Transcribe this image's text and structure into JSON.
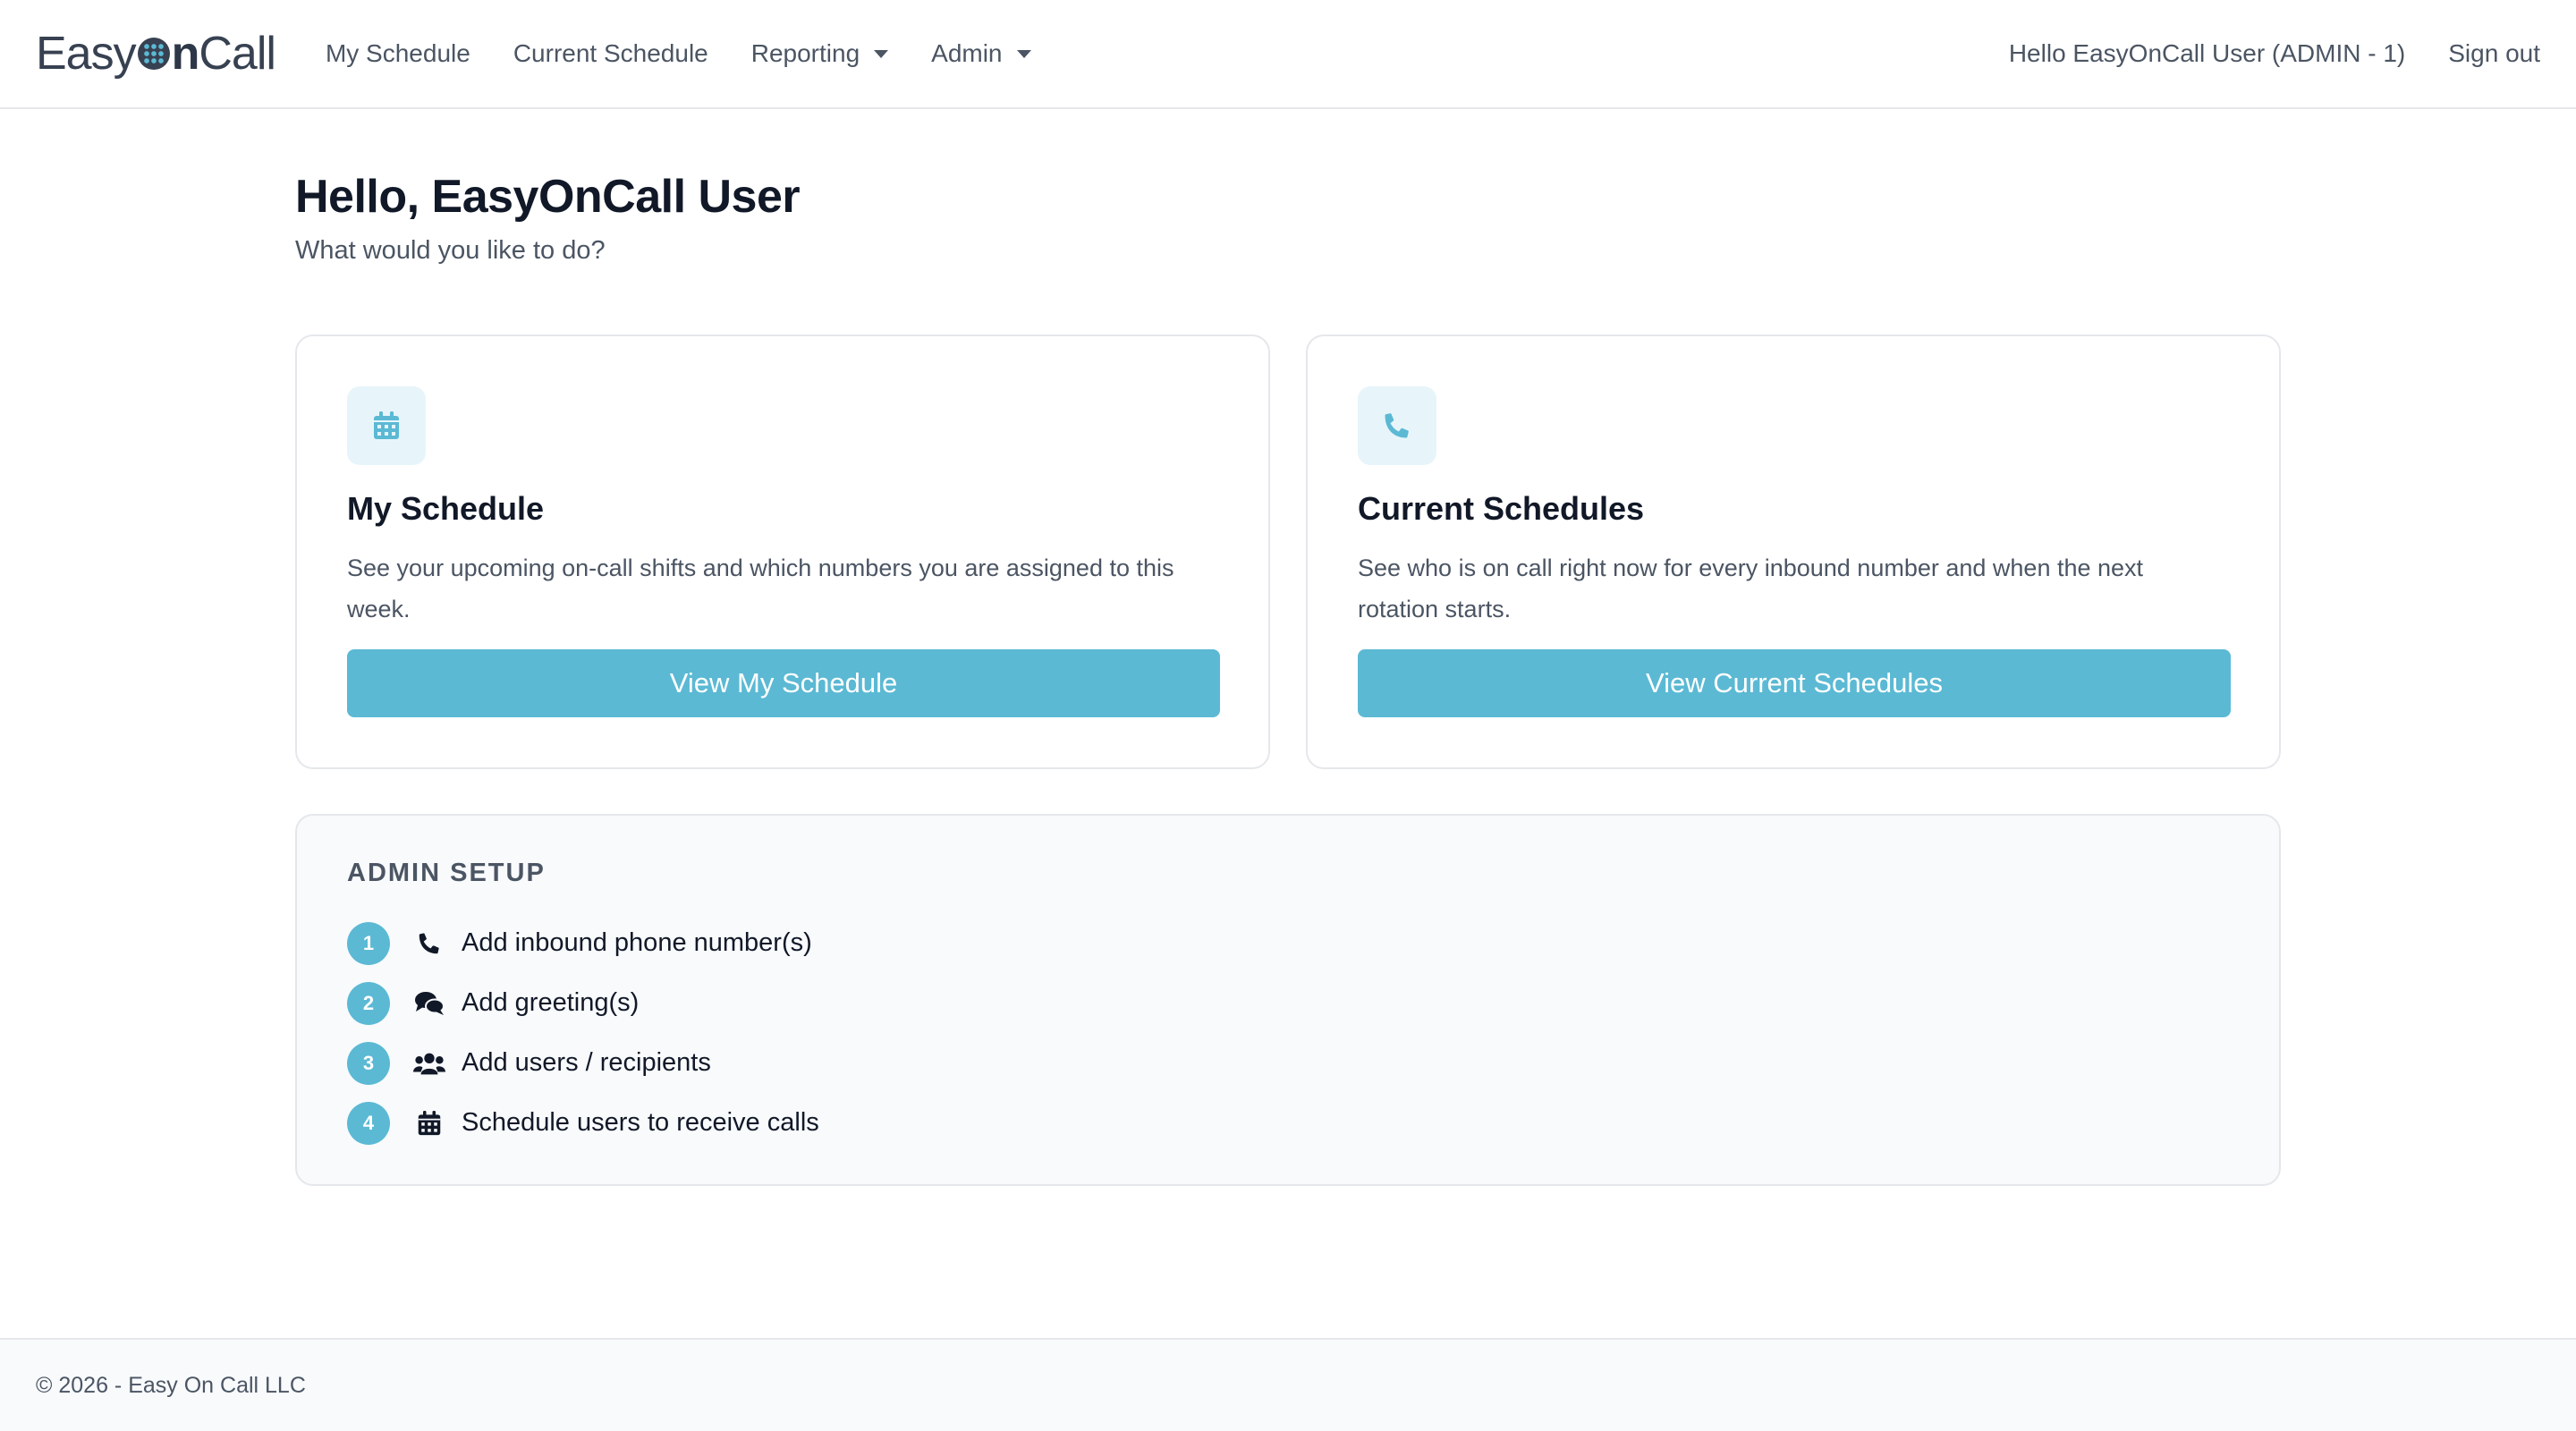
{
  "brand": {
    "part1": "Easy",
    "part2": "n",
    "part3": "Call"
  },
  "nav": {
    "my_schedule": "My Schedule",
    "current_schedule": "Current Schedule",
    "reporting": "Reporting",
    "admin": "Admin",
    "greeting": "Hello EasyOnCall User (ADMIN - 1)",
    "sign_out": "Sign out"
  },
  "header": {
    "title": "Hello, EasyOnCall User",
    "subtitle": "What would you like to do?"
  },
  "cards": [
    {
      "icon": "calendar-icon",
      "title": "My Schedule",
      "description": "See your upcoming on-call shifts and which numbers you are assigned to this week.",
      "button": "View My Schedule"
    },
    {
      "icon": "phone-icon",
      "title": "Current Schedules",
      "description": "See who is on call right now for every inbound number and when the next rotation starts.",
      "button": "View Current Schedules"
    }
  ],
  "admin_setup": {
    "heading": "ADMIN SETUP",
    "steps": [
      {
        "number": "1",
        "icon": "phone-icon",
        "label": "Add inbound phone number(s)"
      },
      {
        "number": "2",
        "icon": "comments-icon",
        "label": "Add greeting(s)"
      },
      {
        "number": "3",
        "icon": "users-icon",
        "label": "Add users / recipients"
      },
      {
        "number": "4",
        "icon": "calendar-icon",
        "label": "Schedule users to receive calls"
      }
    ]
  },
  "footer": {
    "text": "© 2026 - Easy On Call LLC"
  },
  "colors": {
    "accent": "#5bb9d4",
    "accent_light": "#e7f5fa",
    "text": "#111827",
    "muted": "#4b5563"
  }
}
